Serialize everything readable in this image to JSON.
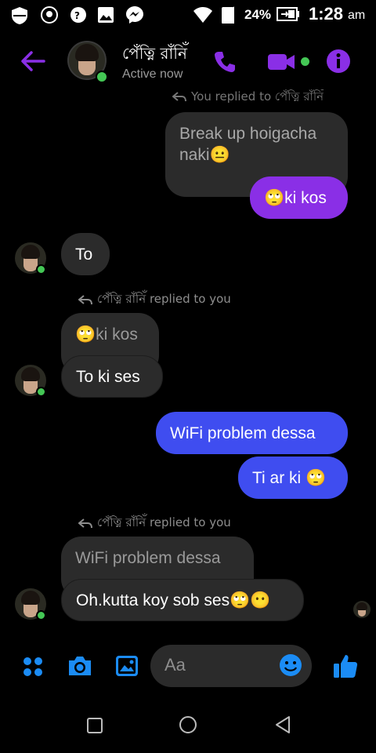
{
  "status_bar": {
    "battery_percent": "24%",
    "time": "1:28",
    "ampm": "am"
  },
  "header": {
    "name": "পেঁত্নি রাঁনিঁ",
    "status": "Active now"
  },
  "messages": {
    "top_reply_note": "You replied to পেঁত্নি রাঁনিঁ",
    "quoted_top": "Break up hoigacha naki😐",
    "m1": "🙄ki kos",
    "m2": "To",
    "reply_note_1": "পেঁত্নি রাঁনিঁ replied to you",
    "quoted_1": "🙄ki kos",
    "m3": "To ki ses",
    "m4": "WiFi problem dessa",
    "m5": "Ti ar ki 🙄",
    "reply_note_2": "পেঁত্নি রাঁনিঁ replied to you",
    "quoted_2": "WiFi problem dessa",
    "m6": "Oh.kutta koy sob ses🙄😶"
  },
  "composer": {
    "placeholder": "Aa"
  },
  "colors": {
    "accent": "#8a2fe6",
    "blue": "#3f4df0",
    "icon_blue": "#1b8cf5",
    "online": "#44c755"
  }
}
